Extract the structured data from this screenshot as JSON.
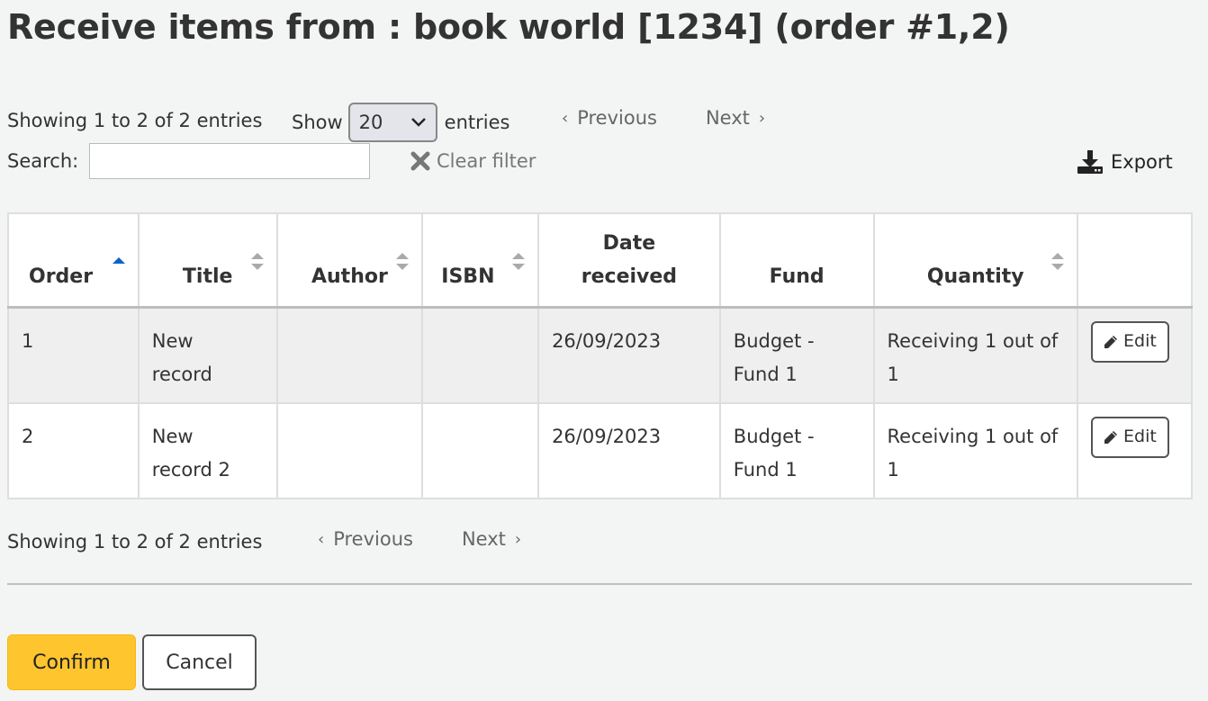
{
  "page": {
    "title": "Receive items from : book world [1234] (order #1,2)"
  },
  "controls": {
    "info_top": "Showing 1 to 2 of 2 entries",
    "show_label": "Show",
    "page_size": "20",
    "entries_label": "entries",
    "previous_label": "Previous",
    "next_label": "Next",
    "search_label": "Search:",
    "search_value": "",
    "clear_filter_label": "Clear filter",
    "export_label": "Export"
  },
  "table": {
    "headers": {
      "order": "Order",
      "title": "Title",
      "author": "Author",
      "isbn": "ISBN",
      "date_line1": "Date",
      "date_line2": "received",
      "fund": "Fund",
      "quantity": "Quantity"
    },
    "rows": [
      {
        "order": "1",
        "title": "New record",
        "author": "",
        "isbn": "",
        "date_received": "26/09/2023",
        "fund": "Budget - Fund 1",
        "quantity": "Receiving 1 out of 1",
        "action": "Edit"
      },
      {
        "order": "2",
        "title": "New record 2",
        "author": "",
        "isbn": "",
        "date_received": "26/09/2023",
        "fund": "Budget - Fund 1",
        "quantity": "Receiving 1 out of 1",
        "action": "Edit"
      }
    ]
  },
  "footer": {
    "info_bottom": "Showing 1 to 2 of 2 entries",
    "confirm_label": "Confirm",
    "cancel_label": "Cancel"
  },
  "colors": {
    "background": "#f3f4f4",
    "confirm": "#fec52e",
    "sort_active": "#0b63c5"
  }
}
